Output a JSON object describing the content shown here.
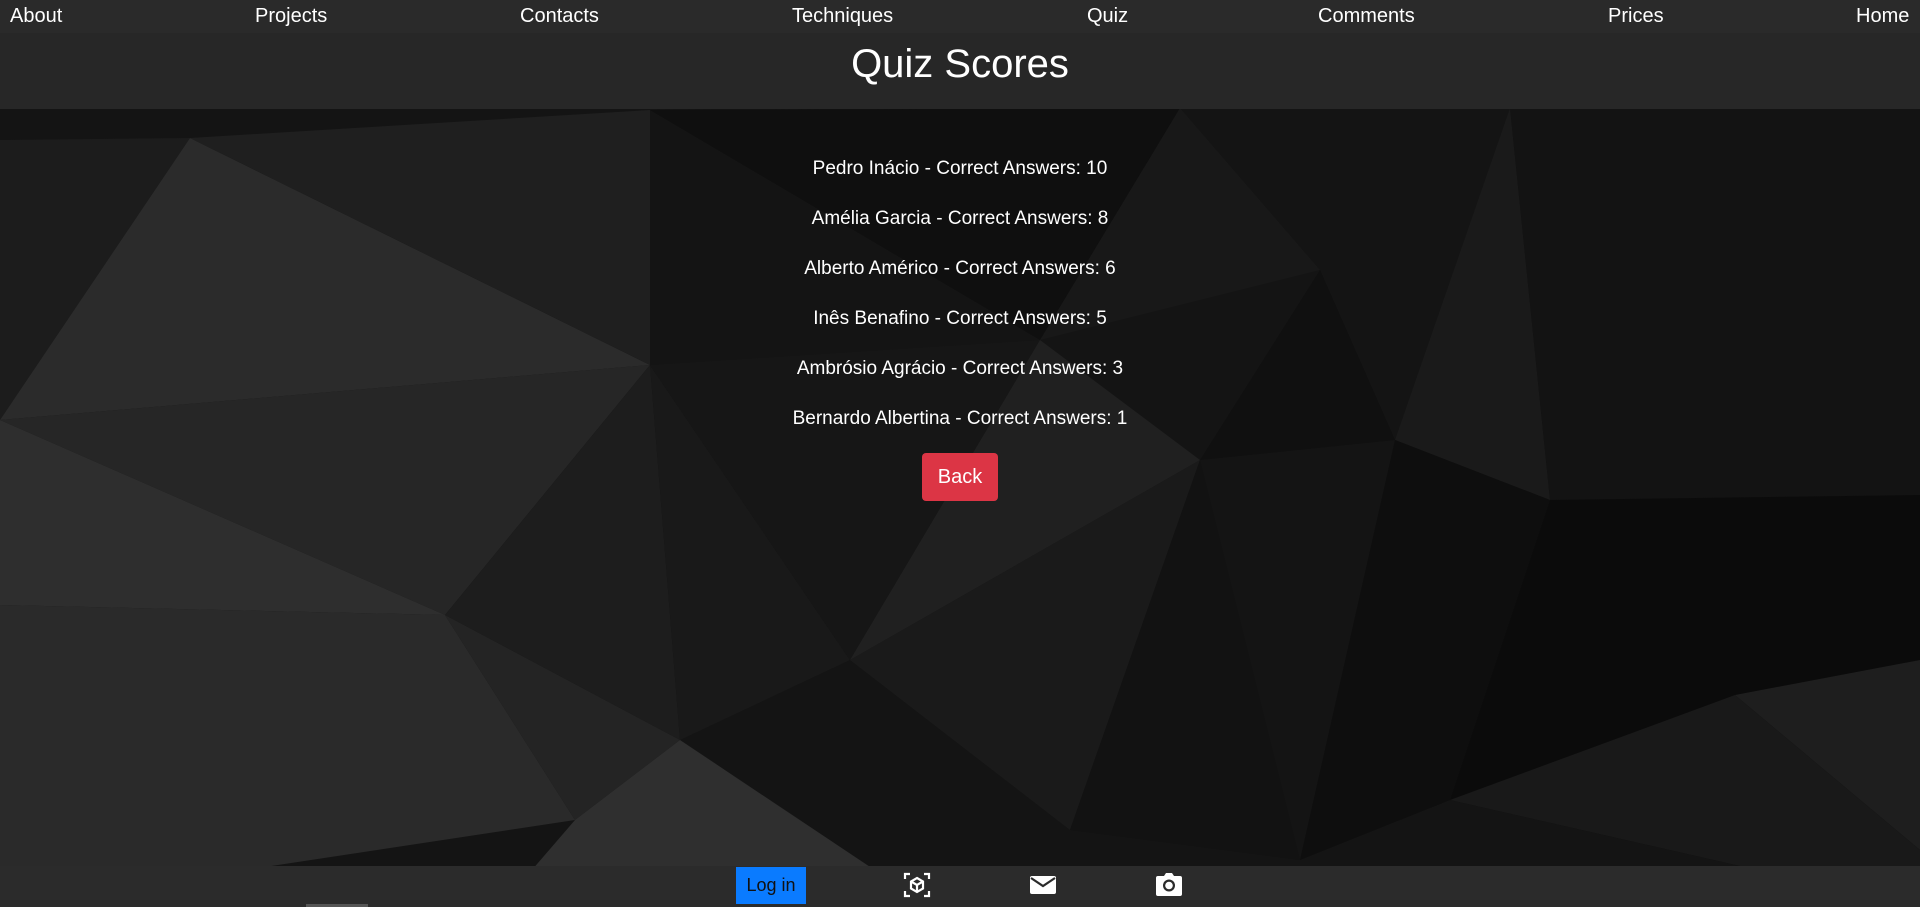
{
  "nav": {
    "items": [
      "About",
      "Projects",
      "Contacts",
      "Techniques",
      "Quiz",
      "Comments",
      "Prices",
      "Home"
    ]
  },
  "header": {
    "title": "Quiz Scores"
  },
  "scores": [
    "Pedro Inácio - Correct Answers: 10",
    "Amélia Garcia - Correct Answers: 8",
    "Alberto Américo - Correct Answers: 6",
    "Inês Benafino - Correct Answers: 5",
    "Ambrósio Agrácio - Correct Answers: 3",
    "Bernardo Albertina - Correct Answers: 1"
  ],
  "actions": {
    "back_label": "Back"
  },
  "footer": {
    "login_label": "Log in",
    "icons": [
      "cube-icon",
      "mail-icon",
      "camera-icon"
    ]
  },
  "colors": {
    "nav_bg": "#2a2a2a",
    "back_button": "#dc3545",
    "login_button": "#0a7bff"
  }
}
